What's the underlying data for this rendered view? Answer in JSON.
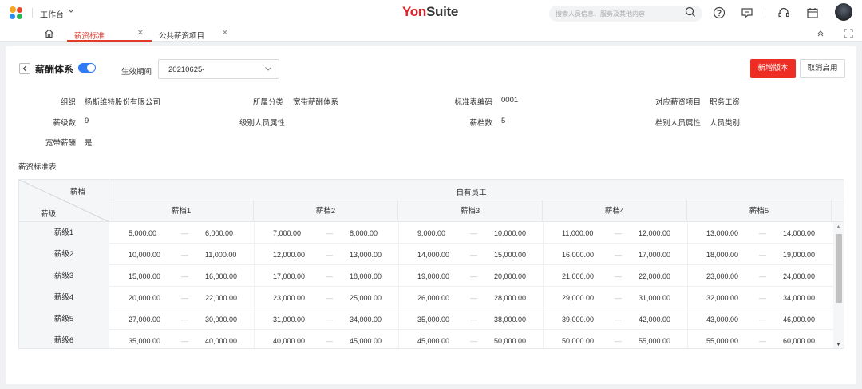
{
  "topbar": {
    "workspace_label": "工作台",
    "brand_yon": "Yon",
    "brand_suite": "Suite",
    "search_placeholder": "搜索人员信息、服务及其他内容"
  },
  "tabs": [
    {
      "label": "薪资标准"
    },
    {
      "label": "公共薪资项目"
    }
  ],
  "header": {
    "title": "薪酬体系",
    "enabled": true,
    "period_label": "生效期间",
    "period_value": "20210625-",
    "new_version_label": "新增版本",
    "cancel_enable_label": "取消启用"
  },
  "fields": {
    "org_label": "组织",
    "org_value": "杨斯维特股份有限公司",
    "category_label": "所属分类",
    "category_value": "宽带薪酬体系",
    "code_label": "标准表编码",
    "code_value": "0001",
    "item_label": "对应薪资项目",
    "item_value": "职务工资",
    "grades_label": "薪级数",
    "grades_value": "9",
    "grade_attr_label": "级别人员属性",
    "grade_attr_value": "",
    "levels_label": "薪档数",
    "levels_value": "5",
    "level_attr_label": "档别人员属性",
    "level_attr_value": "人员类别",
    "broadband_label": "宽带薪酬",
    "broadband_value": "是"
  },
  "section_title": "薪资标准表",
  "table": {
    "corner_top": "薪档",
    "corner_bottom": "薪级",
    "group_header": "自有员工",
    "columns": [
      "薪档1",
      "薪档2",
      "薪档3",
      "薪档4",
      "薪档5"
    ],
    "range_separator": "—",
    "rows": [
      {
        "grade": "薪级1",
        "ranges": [
          [
            "5,000.00",
            "6,000.00"
          ],
          [
            "7,000.00",
            "8,000.00"
          ],
          [
            "9,000.00",
            "10,000.00"
          ],
          [
            "11,000.00",
            "12,000.00"
          ],
          [
            "13,000.00",
            "14,000.00"
          ]
        ]
      },
      {
        "grade": "薪级2",
        "ranges": [
          [
            "10,000.00",
            "11,000.00"
          ],
          [
            "12,000.00",
            "13,000.00"
          ],
          [
            "14,000.00",
            "15,000.00"
          ],
          [
            "16,000.00",
            "17,000.00"
          ],
          [
            "18,000.00",
            "19,000.00"
          ]
        ]
      },
      {
        "grade": "薪级3",
        "ranges": [
          [
            "15,000.00",
            "16,000.00"
          ],
          [
            "17,000.00",
            "18,000.00"
          ],
          [
            "19,000.00",
            "20,000.00"
          ],
          [
            "21,000.00",
            "22,000.00"
          ],
          [
            "23,000.00",
            "24,000.00"
          ]
        ]
      },
      {
        "grade": "薪级4",
        "ranges": [
          [
            "20,000.00",
            "22,000.00"
          ],
          [
            "23,000.00",
            "25,000.00"
          ],
          [
            "26,000.00",
            "28,000.00"
          ],
          [
            "29,000.00",
            "31,000.00"
          ],
          [
            "32,000.00",
            "34,000.00"
          ]
        ]
      },
      {
        "grade": "薪级5",
        "ranges": [
          [
            "27,000.00",
            "30,000.00"
          ],
          [
            "31,000.00",
            "34,000.00"
          ],
          [
            "35,000.00",
            "38,000.00"
          ],
          [
            "39,000.00",
            "42,000.00"
          ],
          [
            "43,000.00",
            "46,000.00"
          ]
        ]
      },
      {
        "grade": "薪级6",
        "ranges": [
          [
            "35,000.00",
            "40,000.00"
          ],
          [
            "40,000.00",
            "45,000.00"
          ],
          [
            "45,000.00",
            "50,000.00"
          ],
          [
            "50,000.00",
            "55,000.00"
          ],
          [
            "55,000.00",
            "60,000.00"
          ]
        ]
      }
    ]
  }
}
